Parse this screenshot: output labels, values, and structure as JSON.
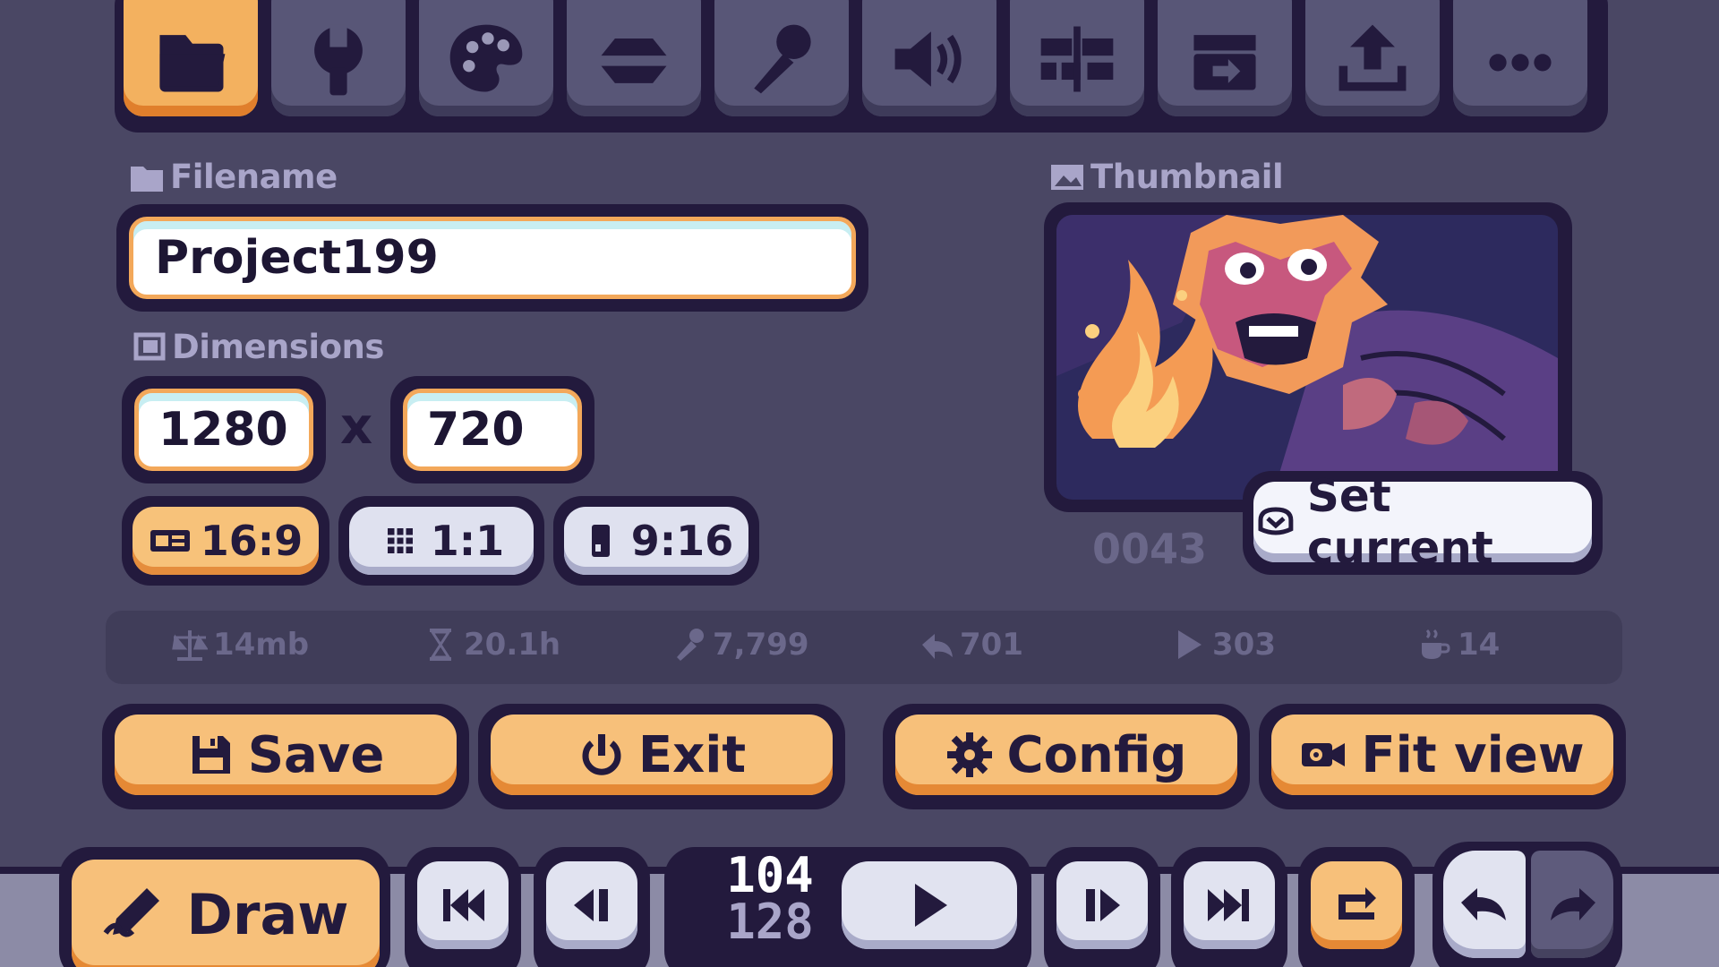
{
  "toolbar": {
    "tools": [
      {
        "icon": "folder-icon",
        "active": true
      },
      {
        "icon": "wrench-icon",
        "active": false
      },
      {
        "icon": "palette-icon",
        "active": false
      },
      {
        "icon": "layers-icon",
        "active": false
      },
      {
        "icon": "brush-icon",
        "active": false
      },
      {
        "icon": "speaker-icon",
        "active": false
      },
      {
        "icon": "timeline-icon",
        "active": false
      },
      {
        "icon": "clapperboard-export-icon",
        "active": false
      },
      {
        "icon": "upload-icon",
        "active": false
      },
      {
        "icon": "more-icon",
        "active": false
      }
    ]
  },
  "file": {
    "filename_label": "Filename",
    "filename_value": "Project199",
    "dimensions_label": "Dimensions",
    "width": "1280",
    "separator": "x",
    "height": "720",
    "ratios": [
      {
        "label": "16:9",
        "icon": "widescreen-icon",
        "selected": true
      },
      {
        "label": "1:1",
        "icon": "grid-icon",
        "selected": false
      },
      {
        "label": "9:16",
        "icon": "phone-icon",
        "selected": false
      }
    ]
  },
  "thumbnail": {
    "label": "Thumbnail",
    "frame_number": "0043",
    "set_current_label": "Set current"
  },
  "stats": [
    {
      "icon": "scale-icon",
      "value": "14mb"
    },
    {
      "icon": "hourglass-icon",
      "value": "20.1h"
    },
    {
      "icon": "brush-stroke-icon",
      "value": "7,799"
    },
    {
      "icon": "undo-arrow-icon",
      "value": "701"
    },
    {
      "icon": "play-icon",
      "value": "303"
    },
    {
      "icon": "coffee-icon",
      "value": "14"
    }
  ],
  "actions": {
    "save": "Save",
    "exit": "Exit",
    "config": "Config",
    "fit_view": "Fit view"
  },
  "playback": {
    "draw_label": "Draw",
    "current_frame": "104",
    "total_frames": "128"
  },
  "colors": {
    "background": "#4a4764",
    "accent_orange": "#f7c07a",
    "outline": "#231a3d",
    "button_light": "#e1e3f0",
    "label_text": "#a9a5c9"
  }
}
